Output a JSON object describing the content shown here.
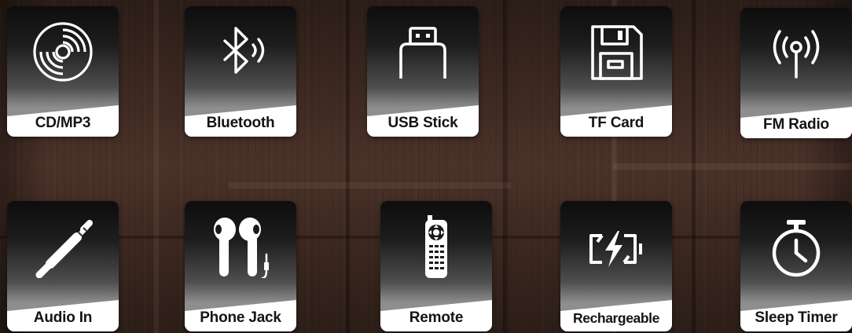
{
  "features": [
    {
      "label": "CD/MP3",
      "icon": "cd-disc-icon"
    },
    {
      "label": "Bluetooth",
      "icon": "bluetooth-icon"
    },
    {
      "label": "USB Stick",
      "icon": "usb-stick-icon"
    },
    {
      "label": "TF Card",
      "icon": "floppy-disk-icon"
    },
    {
      "label": "FM Radio",
      "icon": "radio-antenna-icon"
    },
    {
      "label": "Audio In",
      "icon": "audio-jack-icon"
    },
    {
      "label": "Phone Jack",
      "icon": "earbuds-icon"
    },
    {
      "label": "Remote",
      "icon": "remote-control-icon"
    },
    {
      "label": "Rechargeable",
      "icon": "rechargeable-battery-icon"
    },
    {
      "label": "Sleep Timer",
      "icon": "stopwatch-icon"
    }
  ],
  "colors": {
    "tile_top": "#0d0d0d",
    "tile_bottom": "#8e8e8e",
    "caption_bg": "#ffffff",
    "caption_text": "#141414",
    "icon": "#ffffff",
    "background_wood": "#3e2a22"
  }
}
